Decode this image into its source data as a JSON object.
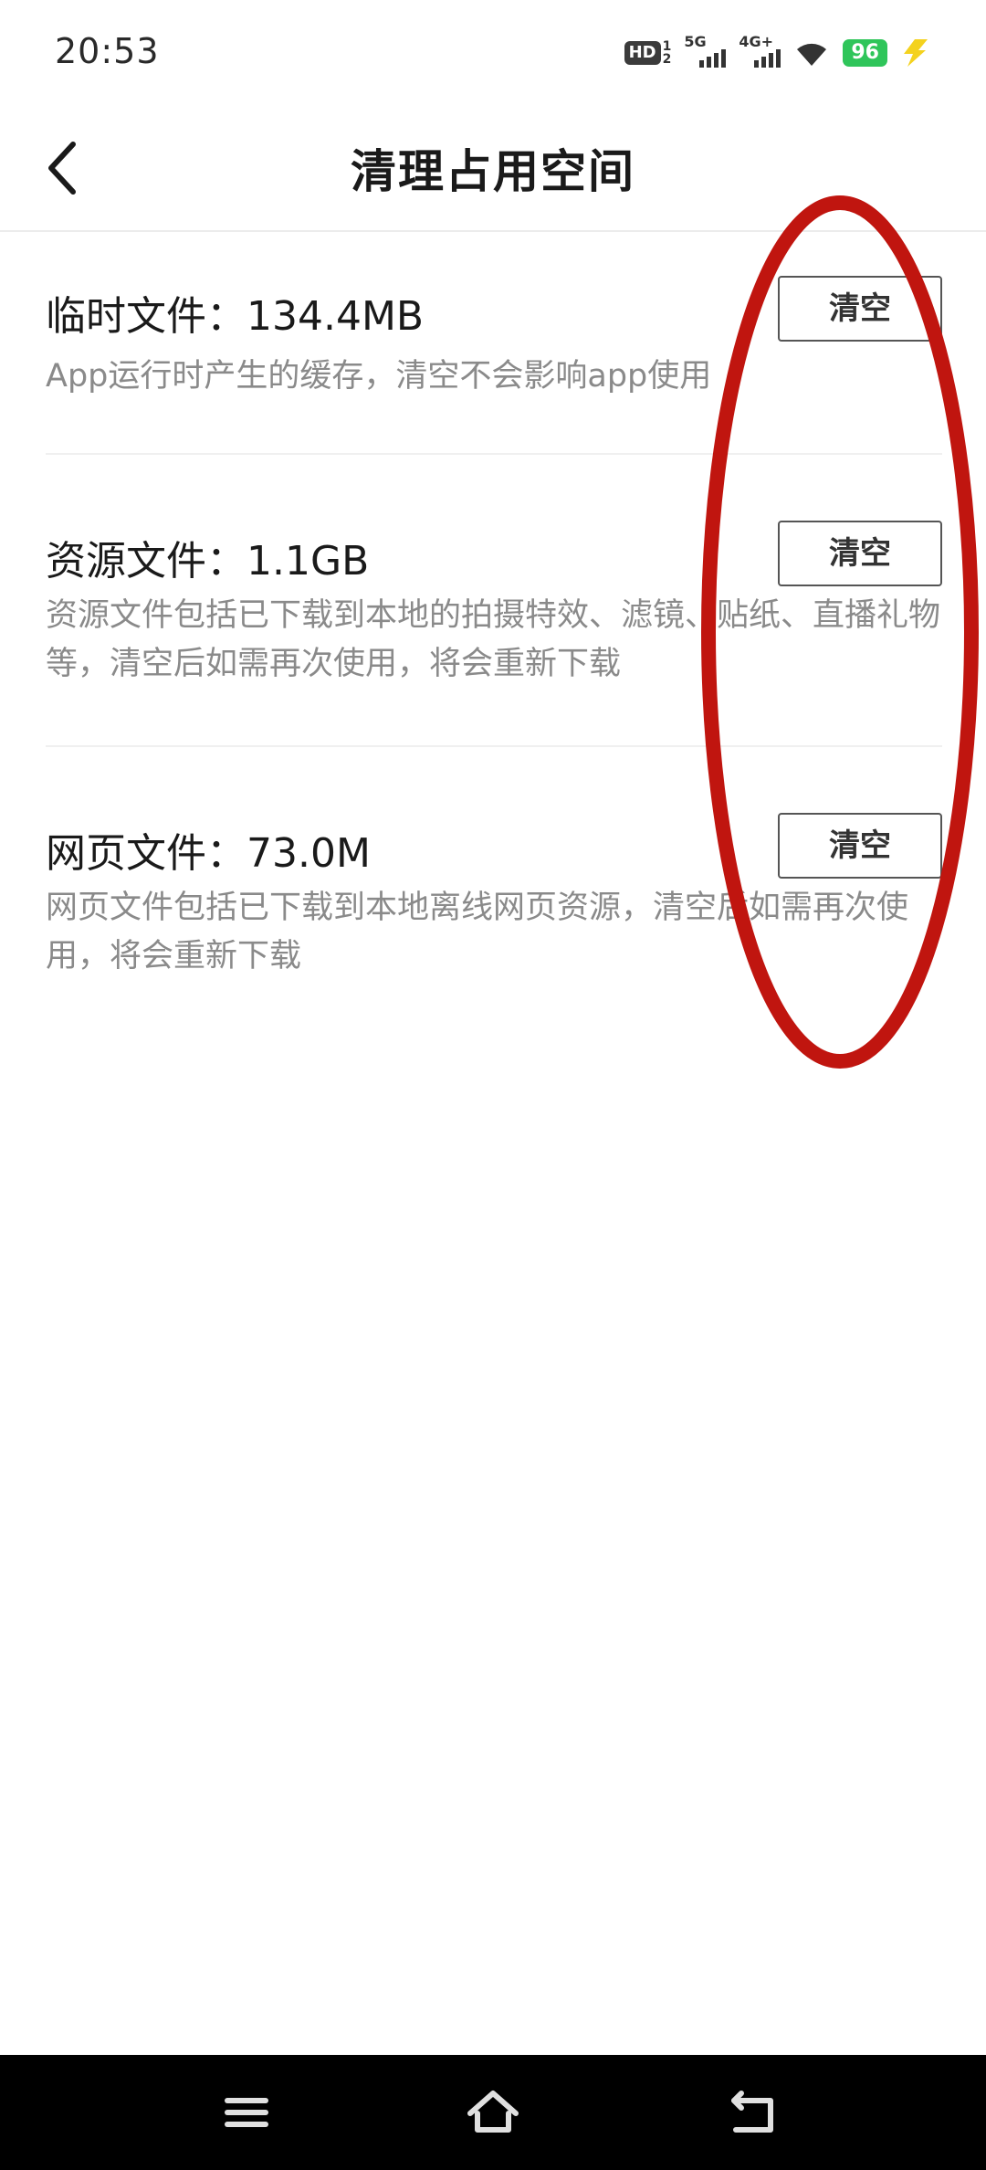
{
  "status_bar": {
    "time": "20:53",
    "hd_label": "HD",
    "hd_sub_top": "1",
    "hd_sub_bottom": "2",
    "network_1": "5G",
    "network_2": "4G+",
    "battery": "96"
  },
  "header": {
    "title": "清理占用空间"
  },
  "items": [
    {
      "title": "临时文件：134.4MB",
      "description": "App运行时产生的缓存，清空不会影响app使用",
      "button": "清空"
    },
    {
      "title": "资源文件：1.1GB",
      "description": "资源文件包括已下载到本地的拍摄特效、滤镜、贴纸、直播礼物等，清空后如需再次使用，将会重新下载",
      "button": "清空"
    },
    {
      "title": "网页文件：73.0M",
      "description": "网页文件包括已下载到本地离线网页资源，清空后如需再次使用，将会重新下载",
      "button": "清空"
    }
  ],
  "icons": {
    "back": "chevron-left-icon",
    "wifi": "wifi-icon",
    "charging": "lightning-icon",
    "nav_menu": "menu-icon",
    "nav_home": "home-icon",
    "nav_back": "back-icon"
  },
  "colors": {
    "annotation": "#c0150f",
    "battery": "#2fc55a",
    "charging": "#f4d21e",
    "nav_bar": "#000000"
  }
}
